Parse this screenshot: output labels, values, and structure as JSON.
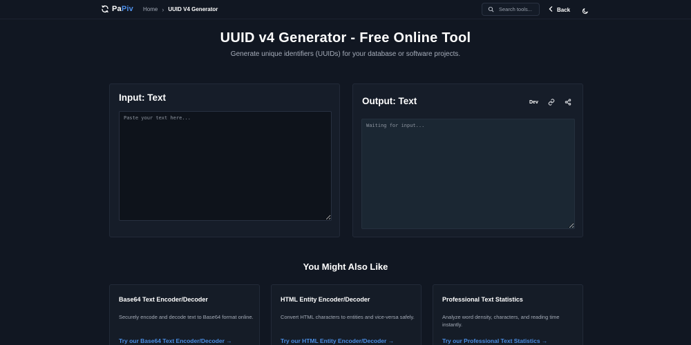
{
  "header": {
    "brand_prefix": "Pa",
    "brand_suffix": "Piv",
    "breadcrumb_home": "Home",
    "breadcrumb_current": "UUID V4 Generator",
    "search_placeholder": "Search tools...",
    "back_label": "Back",
    "icons": {
      "logo": "refresh-icon",
      "search": "search-icon",
      "back": "chevron-left-icon",
      "theme": "moon-icon"
    }
  },
  "hero": {
    "title": "UUID v4 Generator - Free Online Tool",
    "subtitle": "Generate unique identifiers (UUIDs) for your database or software projects."
  },
  "input_panel": {
    "title": "Input: Text",
    "placeholder": "Paste your text here..."
  },
  "output_panel": {
    "title": "Output: Text",
    "placeholder": "Waiting for input...",
    "dev_label": "Dev",
    "icons": [
      "link-icon",
      "share-icon"
    ]
  },
  "related": {
    "title": "You Might Also Like",
    "cards": [
      {
        "title": "Base64 Text Encoder/Decoder",
        "description": "Securely encode and decode text to Base64 format online.",
        "link": "Try our Base64 Text Encoder/Decoder →"
      },
      {
        "title": "HTML Entity Encoder/Decoder",
        "description": "Convert HTML characters to entities and vice-versa safely.",
        "link": "Try our HTML Entity Encoder/Decoder →"
      },
      {
        "title": "Professional Text Statistics",
        "description": "Analyze word density, characters, and reading time instantly.",
        "link": "Try our Professional Text Statistics →"
      }
    ]
  },
  "colors": {
    "background": "#111722",
    "panel": "#161d29",
    "accent": "#4a8fe6",
    "text": "#ffffff",
    "muted": "#a7aebb"
  }
}
